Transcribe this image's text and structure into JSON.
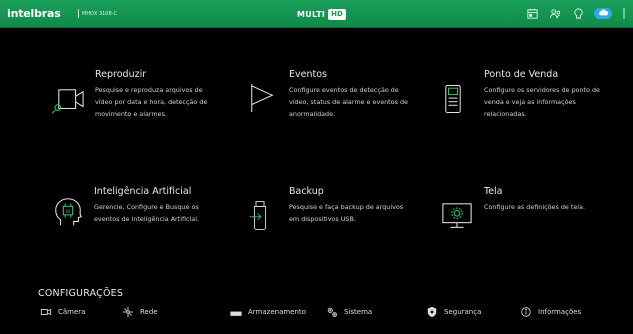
{
  "header": {
    "brand": "intelbras",
    "model": "MHDX 3108-C",
    "logo_main": "MULTI",
    "logo_badge": "HD",
    "icons": [
      "calendar-icon",
      "users-icon",
      "ptz-icon",
      "cloud-icon",
      "close-icon"
    ],
    "colors": {
      "bar": "#12914e",
      "cloud": "#2fa9e8"
    }
  },
  "tiles": [
    {
      "title": "Reproduzir",
      "desc": [
        "Pesquise e reproduza arquivos de",
        "vídeo por data e hora, detecção de",
        "movimento e alarmes."
      ],
      "icon": "playback-camera-icon"
    },
    {
      "title": "Eventos",
      "desc": [
        "Configure eventos de detecção de",
        "vídeo, status de alarme e eventos de",
        "anormalidade."
      ],
      "icon": "flag-icon"
    },
    {
      "title": "Ponto de Venda",
      "desc": [
        "Configure os servidores de ponto de",
        "venda e veja as informações",
        "relacionadas."
      ],
      "icon": "pos-terminal-icon"
    },
    {
      "title": "Inteligência Artificial",
      "desc": [
        "Gerencie, Configure e Busque os",
        "eventos de Inteligência Artificial."
      ],
      "icon": "ai-head-icon"
    },
    {
      "title": "Backup",
      "desc": [
        "Pesquise e faça backup de arquivos",
        "em dispositivos USB."
      ],
      "icon": "usb-backup-icon"
    },
    {
      "title": "Tela",
      "desc": [
        "Configure as definições de tela."
      ],
      "icon": "monitor-settings-icon"
    }
  ],
  "config": {
    "title": "CONFIGURAÇÕES",
    "items": [
      {
        "label": "Câmera",
        "icon": "camera-icon"
      },
      {
        "label": "Rede",
        "icon": "network-icon"
      },
      {
        "label": "Armazenamento",
        "icon": "storage-icon"
      },
      {
        "label": "Sistema",
        "icon": "gears-icon"
      },
      {
        "label": "Segurança",
        "icon": "shield-icon"
      },
      {
        "label": "Informações",
        "icon": "info-icon"
      }
    ]
  }
}
